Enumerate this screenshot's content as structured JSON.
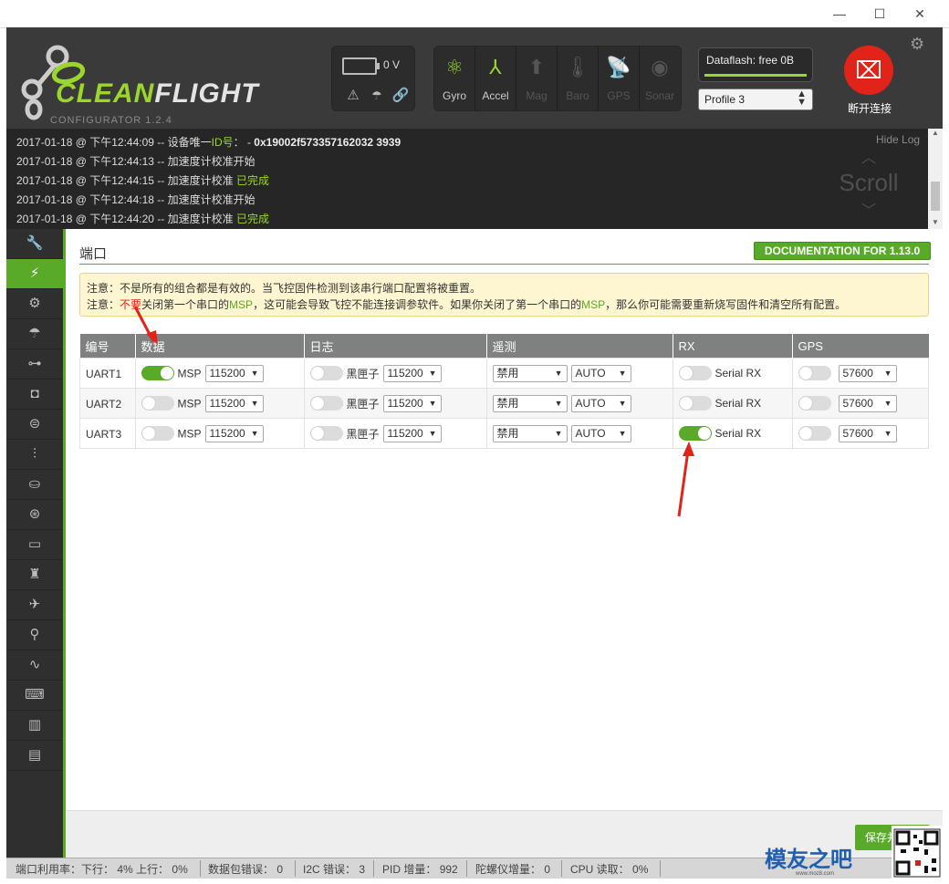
{
  "window": {
    "min": "—",
    "max": "☐",
    "close": "✕"
  },
  "header": {
    "logo_clean": "CLEAN",
    "logo_flight": "FLIGHT",
    "version": "CONFIGURATOR  1.2.4",
    "voltage": "0 V",
    "sensors": [
      {
        "label": "Gyro",
        "icon": "gyro-icon",
        "active": true
      },
      {
        "label": "Accel",
        "icon": "accel-icon",
        "active": true
      },
      {
        "label": "Mag",
        "icon": "mag-icon",
        "active": false
      },
      {
        "label": "Baro",
        "icon": "baro-icon",
        "active": false
      },
      {
        "label": "GPS",
        "icon": "gps-icon",
        "active": false
      },
      {
        "label": "Sonar",
        "icon": "sonar-icon",
        "active": false
      }
    ],
    "dataflash": "Dataflash: free 0B",
    "profile": "Profile 3",
    "disconnect": "断开连接"
  },
  "log": {
    "hide": "Hide Log",
    "scroll": "Scroll",
    "lines": [
      {
        "prefix": "2017-01-18 @ 下午12:44:09 -- 设备唯一",
        "id_label": "ID号",
        "suffix": "： - ",
        "value": "0x19002f573357162032 3939"
      },
      {
        "text": "2017-01-18 @ 下午12:44:13 -- 加速度计校准开始"
      },
      {
        "text": "2017-01-18 @ 下午12:44:15 -- 加速度计校准 ",
        "ok": "已完成"
      },
      {
        "text": "2017-01-18 @ 下午12:44:18 -- 加速度计校准开始"
      },
      {
        "text": "2017-01-18 @ 下午12:44:20 -- 加速度计校准 ",
        "ok": "已完成"
      }
    ]
  },
  "page": {
    "title": "端口",
    "doc_button": "DOCUMENTATION FOR 1.13.0",
    "note1": "注意：不是所有的组合都是有效的。当飞控固件检测到该串行端口配置将被重置。",
    "note2_a": "注意：",
    "note2_red": "不要",
    "note2_b": "关闭第一个串口的",
    "note2_msp1": "MSP",
    "note2_c": "，这可能会导致飞控不能连接调参软件。如果你关闭了第一个串口的",
    "note2_msp2": "MSP",
    "note2_d": "，那么你可能需要重新烧写固件和清空所有配置。",
    "save": "保存并重启"
  },
  "table": {
    "headers": [
      "编号",
      "数据",
      "日志",
      "遥测",
      "RX",
      "GPS"
    ],
    "rows": [
      {
        "id": "UART1",
        "msp_on": true,
        "msp": "MSP",
        "msp_baud": "115200",
        "log_on": false,
        "log": "黑匣子",
        "log_baud": "115200",
        "tel": "禁用",
        "tel_baud": "AUTO",
        "rx_on": false,
        "rx": "Serial RX",
        "gps_on": false,
        "gps_baud": "57600"
      },
      {
        "id": "UART2",
        "msp_on": false,
        "msp": "MSP",
        "msp_baud": "115200",
        "log_on": false,
        "log": "黑匣子",
        "log_baud": "115200",
        "tel": "禁用",
        "tel_baud": "AUTO",
        "rx_on": false,
        "rx": "Serial RX",
        "gps_on": false,
        "gps_baud": "57600"
      },
      {
        "id": "UART3",
        "msp_on": false,
        "msp": "MSP",
        "msp_baud": "115200",
        "log_on": false,
        "log": "黑匣子",
        "log_baud": "115200",
        "tel": "禁用",
        "tel_baud": "AUTO",
        "rx_on": true,
        "rx": "Serial RX",
        "gps_on": false,
        "gps_baud": "57600"
      }
    ]
  },
  "sidebar": {
    "items": [
      {
        "icon": "wrench-icon",
        "glyph": "🔧",
        "active": false
      },
      {
        "icon": "plug-icon",
        "glyph": "⚡",
        "active": true
      },
      {
        "icon": "gear-icon",
        "glyph": "⚙",
        "active": false
      },
      {
        "icon": "parachute-icon",
        "glyph": "☂",
        "active": false
      },
      {
        "icon": "network-icon",
        "glyph": "⊶",
        "active": false
      },
      {
        "icon": "robot-icon",
        "glyph": "◘",
        "active": false
      },
      {
        "icon": "toggle-icon",
        "glyph": "⊜",
        "active": false
      },
      {
        "icon": "sliders-icon",
        "glyph": "⫶",
        "active": false
      },
      {
        "icon": "motor-icon",
        "glyph": "⛀",
        "active": false
      },
      {
        "icon": "satellite-icon",
        "glyph": "⊛",
        "active": false
      },
      {
        "icon": "battery-icon",
        "glyph": "▭",
        "active": false
      },
      {
        "icon": "tower-icon",
        "glyph": "♜",
        "active": false
      },
      {
        "icon": "plane-icon",
        "glyph": "✈",
        "active": false
      },
      {
        "icon": "led-icon",
        "glyph": "⚲",
        "active": false
      },
      {
        "icon": "pulse-icon",
        "glyph": "∿",
        "active": false
      },
      {
        "icon": "keyboard-icon",
        "glyph": "⌨",
        "active": false
      },
      {
        "icon": "chip-icon",
        "glyph": "▥",
        "active": false
      },
      {
        "icon": "window-icon",
        "glyph": "▤",
        "active": false
      }
    ]
  },
  "status": {
    "port_usage": "端口利用率：",
    "down": "下行：",
    "down_val": "4%",
    "up": "上行：",
    "up_val": "0%",
    "packet_err": "数据包错误：",
    "packet_err_val": "0",
    "i2c": "I2C 错误：",
    "i2c_val": "3",
    "pid": "PID 增量：",
    "pid_val": "992",
    "gyro": "陀螺仪增量：",
    "gyro_val": "0",
    "cpu": "CPU 读取：",
    "cpu_val": "0%"
  },
  "watermark": {
    "brand": "模友之吧",
    "url": "www.moz8.com"
  },
  "colors": {
    "accent": "#59aa29",
    "danger": "#e2231a",
    "dark": "#3a3a3a"
  }
}
